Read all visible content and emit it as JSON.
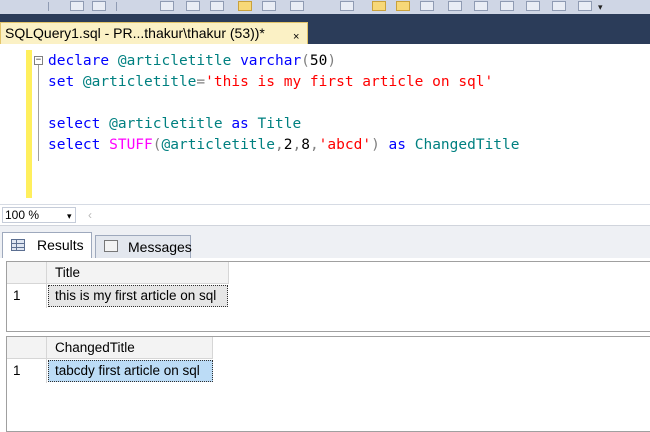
{
  "document_tab": {
    "title": "SQLQuery1.sql - PR...thakur\\thakur (53))*",
    "close_glyph": "×"
  },
  "editor": {
    "fold_glyph": "−",
    "lines": [
      [
        {
          "t": "declare ",
          "c": "kw"
        },
        {
          "t": "@articletitle ",
          "c": "var"
        },
        {
          "t": "varchar",
          "c": "kw"
        },
        {
          "t": "(",
          "c": "gray"
        },
        {
          "t": "50",
          "c": "txt"
        },
        {
          "t": ")",
          "c": "gray"
        }
      ],
      [
        {
          "t": "set ",
          "c": "kw"
        },
        {
          "t": "@articletitle",
          "c": "var"
        },
        {
          "t": "=",
          "c": "gray"
        },
        {
          "t": "'this is my first article on sql'",
          "c": "str"
        }
      ],
      [],
      [
        {
          "t": "select ",
          "c": "kw"
        },
        {
          "t": "@articletitle ",
          "c": "var"
        },
        {
          "t": "as ",
          "c": "kw"
        },
        {
          "t": "Title",
          "c": "var"
        }
      ],
      [
        {
          "t": "select ",
          "c": "kw"
        },
        {
          "t": "STUFF",
          "c": "fn"
        },
        {
          "t": "(",
          "c": "gray"
        },
        {
          "t": "@articletitle",
          "c": "var"
        },
        {
          "t": ",",
          "c": "gray"
        },
        {
          "t": "2",
          "c": "txt"
        },
        {
          "t": ",",
          "c": "gray"
        },
        {
          "t": "8",
          "c": "txt"
        },
        {
          "t": ",",
          "c": "gray"
        },
        {
          "t": "'abcd'",
          "c": "str"
        },
        {
          "t": ") ",
          "c": "gray"
        },
        {
          "t": "as ",
          "c": "kw"
        },
        {
          "t": "ChangedTitle",
          "c": "var"
        }
      ]
    ]
  },
  "zoom": {
    "value": "100 %",
    "arrow": "▾",
    "scroll_left": "‹"
  },
  "result_tabs": {
    "results_label": "Results",
    "messages_label": "Messages"
  },
  "grids": {
    "grid1": {
      "column": "Title",
      "row_number": "1",
      "value": "this is my first article on sql"
    },
    "grid2": {
      "column": "ChangedTitle",
      "row_number": "1",
      "value": "tabcdy first article on sql"
    }
  },
  "colors": {
    "keyword": "#0000ff",
    "function": "#ff00ff",
    "string": "#ff0000",
    "identifier": "#008080",
    "tab_bar": "#2b3c59",
    "active_doc_tab": "#fbf1c5",
    "selected_cell": "#bcdcf6"
  }
}
